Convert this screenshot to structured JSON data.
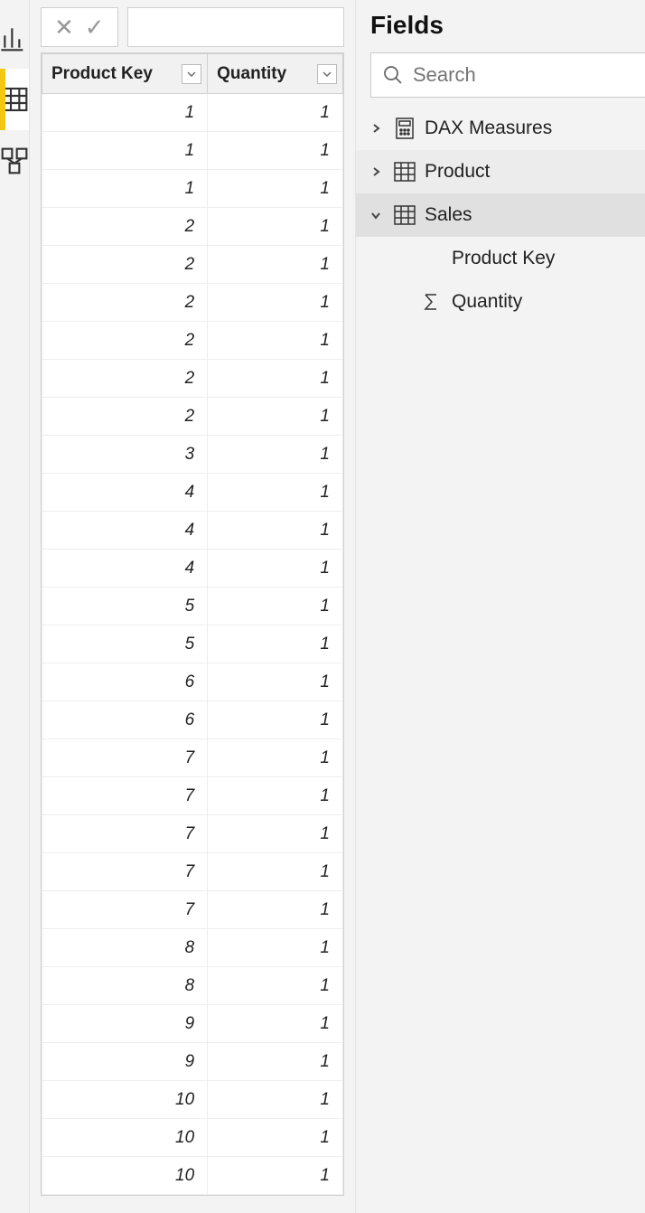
{
  "fields_pane": {
    "title": "Fields",
    "search_placeholder": "Search",
    "tables": [
      {
        "name": "DAX Measures",
        "expanded": false,
        "icon": "calculator"
      },
      {
        "name": "Product",
        "expanded": false,
        "icon": "table"
      },
      {
        "name": "Sales",
        "expanded": true,
        "icon": "table",
        "fields": [
          {
            "name": "Product Key",
            "icon": "none"
          },
          {
            "name": "Quantity",
            "icon": "sigma"
          }
        ]
      }
    ]
  },
  "grid": {
    "headers": [
      "Product Key",
      "Quantity"
    ],
    "rows": [
      [
        1,
        1
      ],
      [
        1,
        1
      ],
      [
        1,
        1
      ],
      [
        2,
        1
      ],
      [
        2,
        1
      ],
      [
        2,
        1
      ],
      [
        2,
        1
      ],
      [
        2,
        1
      ],
      [
        2,
        1
      ],
      [
        3,
        1
      ],
      [
        4,
        1
      ],
      [
        4,
        1
      ],
      [
        4,
        1
      ],
      [
        5,
        1
      ],
      [
        5,
        1
      ],
      [
        6,
        1
      ],
      [
        6,
        1
      ],
      [
        7,
        1
      ],
      [
        7,
        1
      ],
      [
        7,
        1
      ],
      [
        7,
        1
      ],
      [
        7,
        1
      ],
      [
        8,
        1
      ],
      [
        8,
        1
      ],
      [
        9,
        1
      ],
      [
        9,
        1
      ],
      [
        10,
        1
      ],
      [
        10,
        1
      ],
      [
        10,
        1
      ]
    ]
  }
}
